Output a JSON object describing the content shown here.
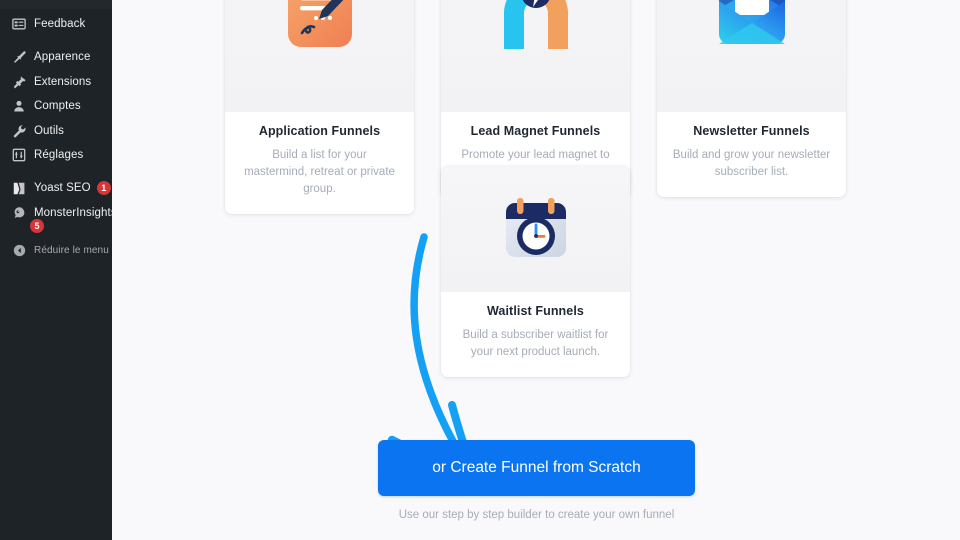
{
  "sidebar": {
    "items": [
      {
        "label": "Feedback",
        "icon": "feedback-icon",
        "badge": null,
        "badge_below": null
      },
      {
        "label": "Apparence",
        "icon": "appearance-brush-icon",
        "badge": null,
        "badge_below": null
      },
      {
        "label": "Extensions",
        "icon": "plugins-plug-icon",
        "badge": null,
        "badge_below": null
      },
      {
        "label": "Comptes",
        "icon": "users-icon",
        "badge": null,
        "badge_below": null
      },
      {
        "label": "Outils",
        "icon": "tools-wrench-icon",
        "badge": null,
        "badge_below": null
      },
      {
        "label": "Réglages",
        "icon": "settings-sliders-icon",
        "badge": null,
        "badge_below": null
      },
      {
        "label": "Yoast SEO",
        "icon": "yoast-seo-icon",
        "badge": "1",
        "badge_below": null
      },
      {
        "label": "MonsterInsights",
        "icon": "monsterinsights-icon",
        "badge": null,
        "badge_below": "5"
      }
    ],
    "collapse": {
      "label": "Réduire le menu",
      "icon": "collapse-arrow-icon"
    }
  },
  "main": {
    "cards": [
      {
        "title": "Application Funnels",
        "description": "Build a list for your mastermind, retreat or private group.",
        "icon": "application-form-pen-icon"
      },
      {
        "title": "Lead Magnet Funnels",
        "description": "Promote your lead magnet to build your subscriber list",
        "icon": "lead-magnet-icon"
      },
      {
        "title": "Newsletter Funnels",
        "description": "Build and grow your newsletter subscriber list.",
        "icon": "newsletter-envelope-icon"
      },
      {
        "title": "Waitlist Funnels",
        "description": "Build a subscriber waitlist for your next product launch.",
        "icon": "waitlist-calendar-clock-icon"
      }
    ],
    "cta": {
      "label": "or Create Funnel from Scratch",
      "caption": "Use our step by step builder to create your own funnel"
    },
    "annotation": {
      "name": "curved-arrow-annotation",
      "color": "#14a0f5"
    }
  },
  "colors": {
    "sidebar_bg": "#1d2327",
    "page_bg": "#f9f9fb",
    "cta_blue": "#0b74f0",
    "badge_red": "#d63638",
    "arrow_blue": "#14a0f5"
  }
}
